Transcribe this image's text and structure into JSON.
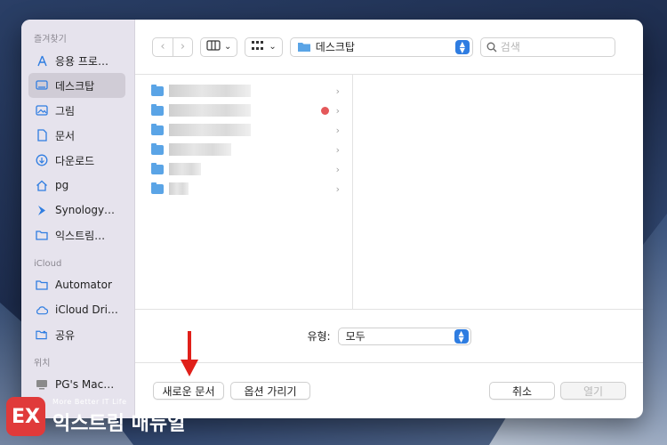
{
  "sidebar": {
    "favorites_header": "즐겨찾기",
    "favorites": [
      {
        "label": "응용 프로…",
        "icon": "applications-icon"
      },
      {
        "label": "데스크탑",
        "icon": "desktop-icon",
        "active": true
      },
      {
        "label": "그림",
        "icon": "pictures-icon"
      },
      {
        "label": "문서",
        "icon": "documents-icon"
      },
      {
        "label": "다운로드",
        "icon": "downloads-icon"
      },
      {
        "label": "pg",
        "icon": "home-icon"
      },
      {
        "label": "Synology…",
        "icon": "synology-icon"
      },
      {
        "label": "익스트림…",
        "icon": "folder-icon"
      }
    ],
    "icloud_header": "iCloud",
    "icloud": [
      {
        "label": "Automator",
        "icon": "folder-icon"
      },
      {
        "label": "iCloud Dri…",
        "icon": "cloud-icon"
      },
      {
        "label": "공유",
        "icon": "shared-folder-icon"
      }
    ],
    "locations_header": "위치",
    "locations": [
      {
        "label": "PG's Mac…",
        "icon": "computer-icon"
      }
    ]
  },
  "toolbar": {
    "location": "데스크탑",
    "search_placeholder": "검색"
  },
  "browser": {
    "rows": [
      {
        "tag": false
      },
      {
        "tag": true
      },
      {
        "tag": false
      },
      {
        "tag": false
      },
      {
        "tag": false
      },
      {
        "tag": false
      }
    ]
  },
  "format": {
    "label": "유형:",
    "value": "모두"
  },
  "buttons": {
    "new_document": "새로운 문서",
    "options": "옵션 가리기",
    "cancel": "취소",
    "open": "열기"
  },
  "watermark": {
    "badge": "EX",
    "tagline": "More Better IT Life",
    "name": "익스트림 매뉴얼"
  },
  "colors": {
    "accent": "#2f7de1",
    "arrow": "#e0201a",
    "tag": "#e4585a"
  }
}
